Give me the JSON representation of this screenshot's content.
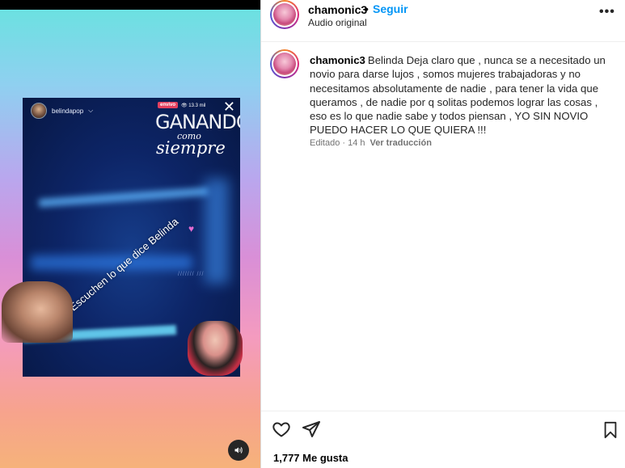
{
  "post": {
    "username": "chamonic3",
    "separator": "•",
    "follow_label": "Seguir",
    "audio_label": "Audio original",
    "more_label": "•••"
  },
  "caption": {
    "username": "chamonic3",
    "text": "Belinda Deja claro que , nunca se a necesitado un novio para darse lujos , somos mujeres trabajadoras y no necesitamos absolutamente de nadie , para tener la vida que queramos , de nadie por q solitas podemos lograr las cosas , eso es lo que nadie sabe y todos piensan , YO SIN NOVIO PUEDO HACER LO QUE QUIERA !!!",
    "edited": "Editado · 14 h",
    "translate_label": "Ver traducción"
  },
  "likes": "1,777 Me gusta",
  "story": {
    "user": "belindapop",
    "chevron": "⌵",
    "live_badge": "envivo",
    "viewers": "👁 13.3 mil",
    "close": "✕",
    "title_line1": "GANANDO",
    "title_line2": "como",
    "title_line3": "siempre",
    "caption": "Escuchen lo que dice Belinda",
    "heart": "♥",
    "watermark": "/////// ///"
  },
  "icons": {
    "audio": "volume-icon",
    "like": "heart-icon",
    "share": "share-icon",
    "save": "bookmark-icon"
  },
  "colors": {
    "follow": "#0095f6",
    "live": "#e4405f"
  }
}
